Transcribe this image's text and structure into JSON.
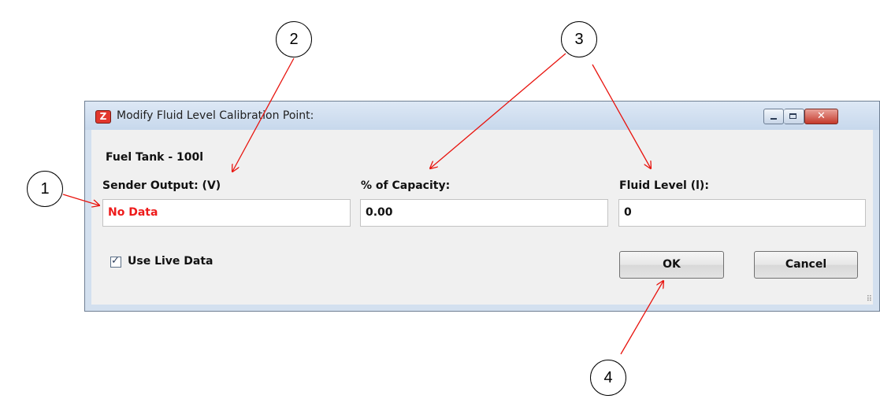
{
  "window": {
    "title": "Modify Fluid Level Calibration Point:",
    "app_icon_glyph": "Z",
    "controls": {
      "close_glyph": "✕"
    },
    "resize_grip_glyph": "⠿"
  },
  "dialog": {
    "tank_name": "Fuel Tank - 100l",
    "fields": [
      {
        "label": "Sender Output: (V)",
        "value": "No Data",
        "value_color": "#ee1b1b"
      },
      {
        "label": "% of Capacity:",
        "value": "0.00"
      },
      {
        "label": "Fluid Level (l):",
        "value": "0"
      }
    ],
    "use_live_data": {
      "label": "Use Live Data",
      "checked": true,
      "check_glyph": "✓"
    },
    "buttons": {
      "ok": "OK",
      "cancel": "Cancel"
    }
  },
  "callouts": [
    "1",
    "2",
    "3",
    "4"
  ],
  "colors": {
    "annotation_arrow": "#e8140e",
    "window_frame": "#d3e0ef",
    "close_button": "#c4392b"
  }
}
